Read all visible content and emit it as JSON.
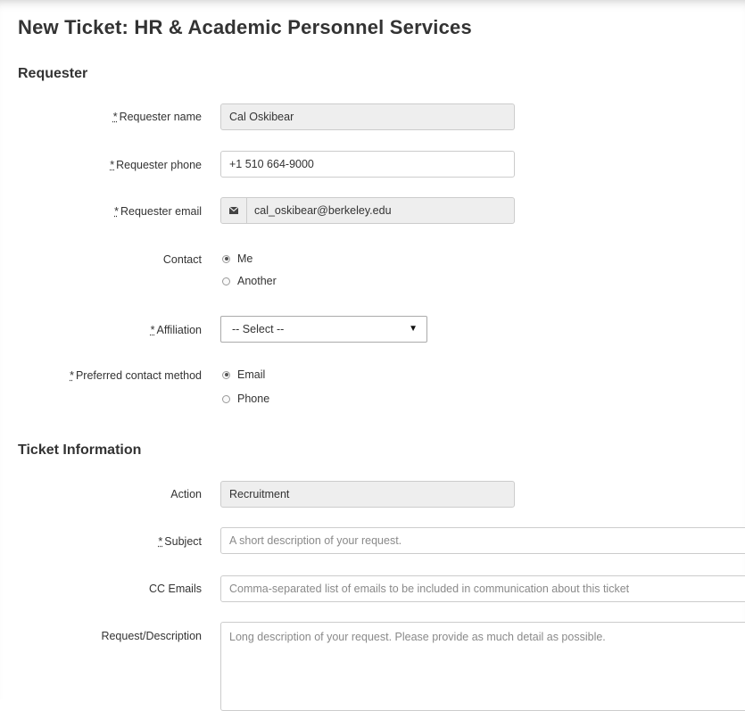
{
  "page": {
    "title": "New Ticket: HR & Academic Personnel Services"
  },
  "requester": {
    "heading": "Requester",
    "required_mark": "*",
    "name": {
      "label": "Requester name",
      "value": "Cal Oskibear"
    },
    "phone": {
      "label": "Requester phone",
      "value": "+1 510 664-9000"
    },
    "email": {
      "label": "Requester email",
      "value": "cal_oskibear@berkeley.edu",
      "icon": "envelope-icon"
    },
    "contact": {
      "label": "Contact",
      "options": [
        "Me",
        "Another"
      ],
      "selected": "Me"
    },
    "affiliation": {
      "label": "Affiliation",
      "value": "-- Select --"
    },
    "preferred_contact": {
      "label": "Preferred contact method",
      "options": [
        "Email",
        "Phone"
      ],
      "selected": "Email"
    }
  },
  "ticket": {
    "heading": "Ticket Information",
    "action": {
      "label": "Action",
      "value": "Recruitment"
    },
    "subject": {
      "label": "Subject",
      "placeholder": "A short description of your request."
    },
    "cc": {
      "label": "CC Emails",
      "placeholder": "Comma-separated list of emails to be included in communication about this ticket"
    },
    "description": {
      "label": "Request/Description",
      "placeholder": "Long description of your request.  Please provide as much detail as possible."
    }
  }
}
